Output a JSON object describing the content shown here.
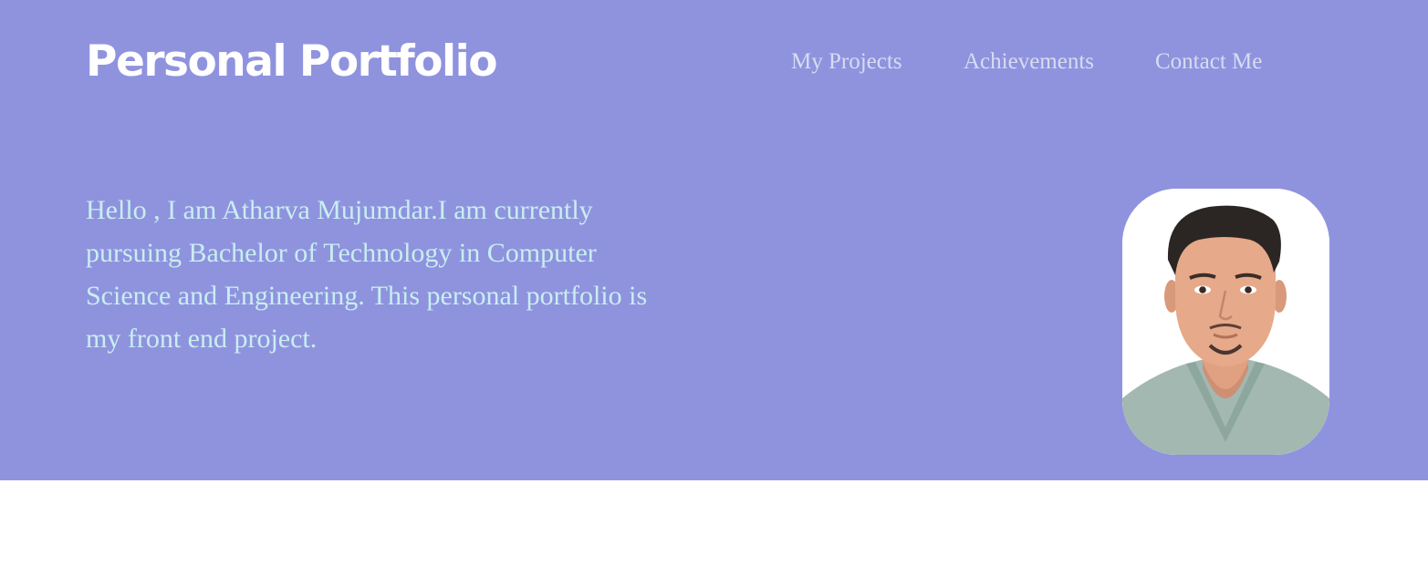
{
  "header": {
    "brand": "Personal Portfolio",
    "nav": [
      "My Projects",
      "Achievements",
      "Contact Me"
    ]
  },
  "hero": {
    "intro": "Hello , I am Atharva Mujumdar.I am currently pursuing Bachelor of Technology in Computer Science and Engineering. This personal portfolio is my front end project.",
    "photo_icon": "profile-photo"
  },
  "colors": {
    "hero_background": "#8f93de",
    "brand_text": "#ffffff",
    "nav_text": "#d6dcf2",
    "intro_text": "#c8eef0",
    "page_background": "#ffffff"
  }
}
